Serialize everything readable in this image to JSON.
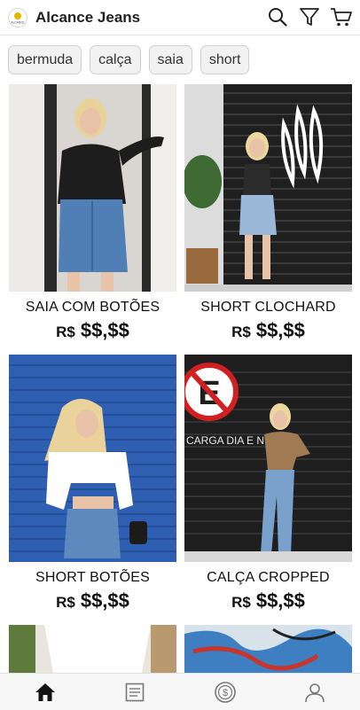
{
  "app": {
    "title": "Alcance Jeans",
    "logo_text": "ALCANCE"
  },
  "filters": [
    "bermuda",
    "calça",
    "saia",
    "short"
  ],
  "products": [
    {
      "name": "SAIA COM BOTÕES",
      "currency": "R$",
      "price": "$$,$$"
    },
    {
      "name": "SHORT CLOCHARD",
      "currency": "R$",
      "price": "$$,$$"
    },
    {
      "name": "SHORT BOTÕES",
      "currency": "R$",
      "price": "$$,$$"
    },
    {
      "name": "CALÇA CROPPED",
      "currency": "R$",
      "price": "$$,$$"
    }
  ],
  "photo_text": {
    "sign": "CARGA DIA E N"
  },
  "nav": [
    "home-icon",
    "catalog-icon",
    "payments-icon",
    "profile-icon"
  ],
  "colors": {
    "accent": "#111111",
    "chip_bg": "#f2f2f2",
    "blue_shutter": "#2f5fb3"
  }
}
